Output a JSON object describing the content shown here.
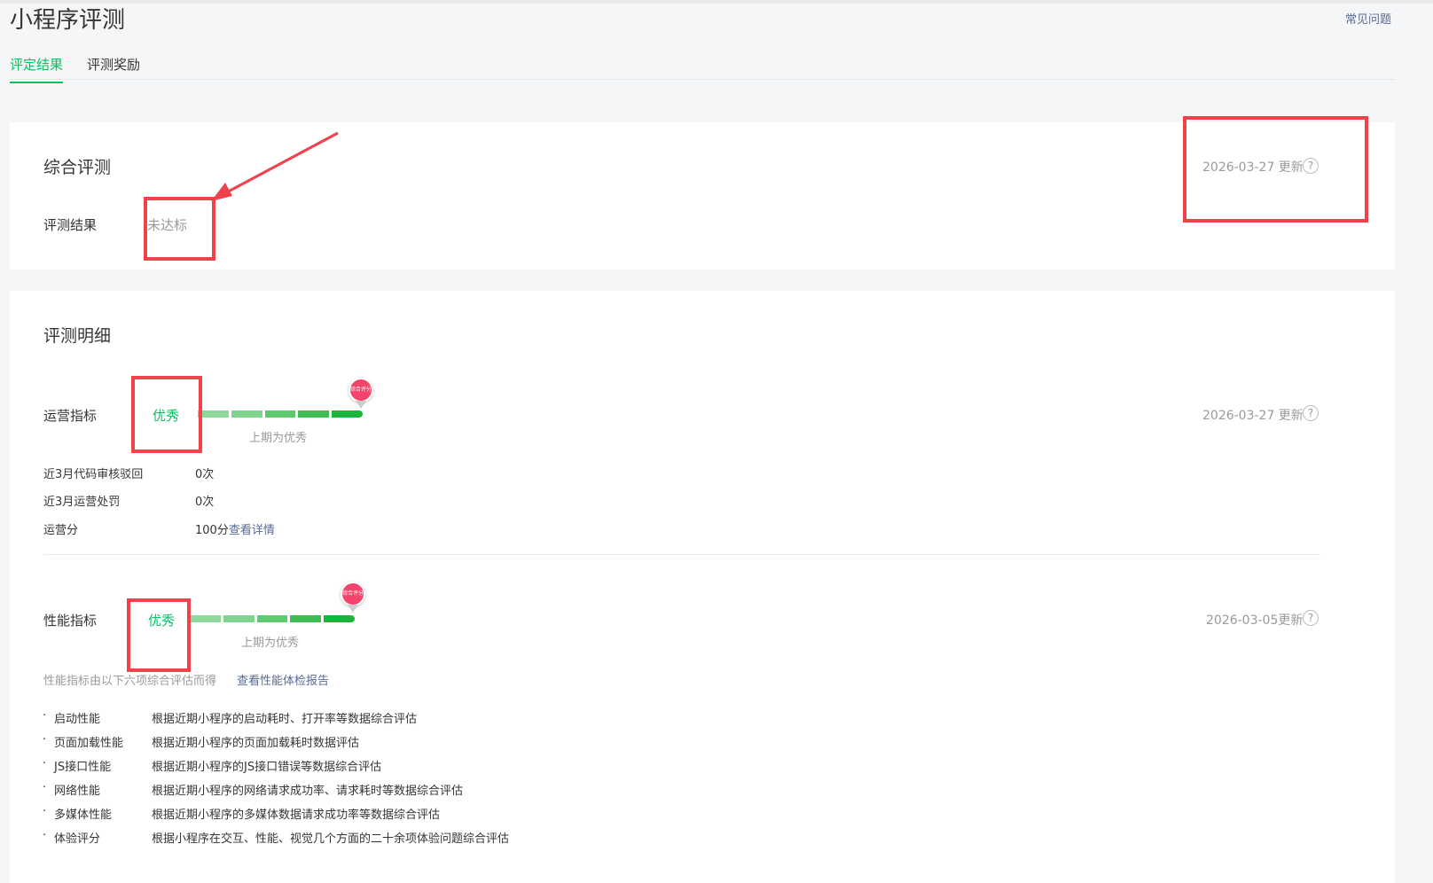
{
  "header": {
    "title": "小程序评测",
    "faq_label": "常见问题"
  },
  "tabs": [
    {
      "label": "评定结果"
    },
    {
      "label": "评测奖励"
    }
  ],
  "summary": {
    "title": "综合评测",
    "updated": "2026-03-27 更新",
    "result_label": "评测结果",
    "result_value": "未达标"
  },
  "detail": {
    "title": "评测明细",
    "operations": {
      "label": "运营指标",
      "grade": "优秀",
      "previous": "上期为优秀",
      "updated": "2026-03-27 更新",
      "badge": "综合评分",
      "items": [
        {
          "key": "近3月代码审核驳回",
          "value": "0次"
        },
        {
          "key": "近3月运营处罚",
          "value": "0次"
        },
        {
          "key": "运营分",
          "value": "100分",
          "link": "查看详情"
        }
      ]
    },
    "performance": {
      "label": "性能指标",
      "grade": "优秀",
      "previous": "上期为优秀",
      "updated": "2026-03-05更新",
      "badge": "综合评分",
      "note": "性能指标由以下六项综合评估而得",
      "report_link": "查看性能体检报告",
      "items": [
        {
          "name": "启动性能",
          "desc": "根据近期小程序的启动耗时、打开率等数据综合评估"
        },
        {
          "name": "页面加载性能",
          "desc": "根据近期小程序的页面加载耗时数据评估"
        },
        {
          "name": "JS接口性能",
          "desc": "根据近期小程序的JS接口错误等数据综合评估"
        },
        {
          "name": "网络性能",
          "desc": "根据近期小程序的网络请求成功率、请求耗时等数据综合评估"
        },
        {
          "name": "多媒体性能",
          "desc": "根据近期小程序的多媒体数据请求成功率等数据综合评估"
        },
        {
          "name": "体验评分",
          "desc": "根据小程序在交互、性能、视觉几个方面的二十余项体验问题综合评估"
        }
      ]
    }
  },
  "bullet": "·",
  "colors": {
    "accent": "#07c160",
    "link": "#576b95",
    "highlight": "#f0424b"
  }
}
